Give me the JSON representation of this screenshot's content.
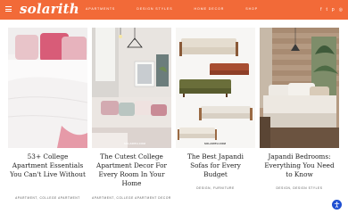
{
  "header": {
    "logo": "solarith",
    "nav": [
      "Apartments",
      "Design Styles",
      "Home Decor",
      "Shop"
    ],
    "social_icons": [
      "facebook-icon",
      "twitter-icon",
      "pinterest-icon",
      "instagram-icon"
    ],
    "social_glyphs": [
      "f",
      "t",
      "p",
      "◎"
    ]
  },
  "colors": {
    "brand": "#f26a38",
    "accessibility": "#1f4fd1"
  },
  "cards": [
    {
      "title": "53+ College Apartment Essentials You Can't Live Without",
      "category": "Apartment, College Apartment",
      "watermark": ""
    },
    {
      "title": "The Cutest College Apartment Decor For Every Room In Your Home",
      "category": "Apartment, College Apartment Decor",
      "watermark": "SOLARITH.COM"
    },
    {
      "title": "The Best Japandi Sofas for Every Budget",
      "category": "Design, Furniture",
      "watermark": "SOLARITH.COM"
    },
    {
      "title": "Japandi Bedrooms: Everything You Need to Know",
      "category": "Design, Design Styles",
      "watermark": ""
    }
  ]
}
